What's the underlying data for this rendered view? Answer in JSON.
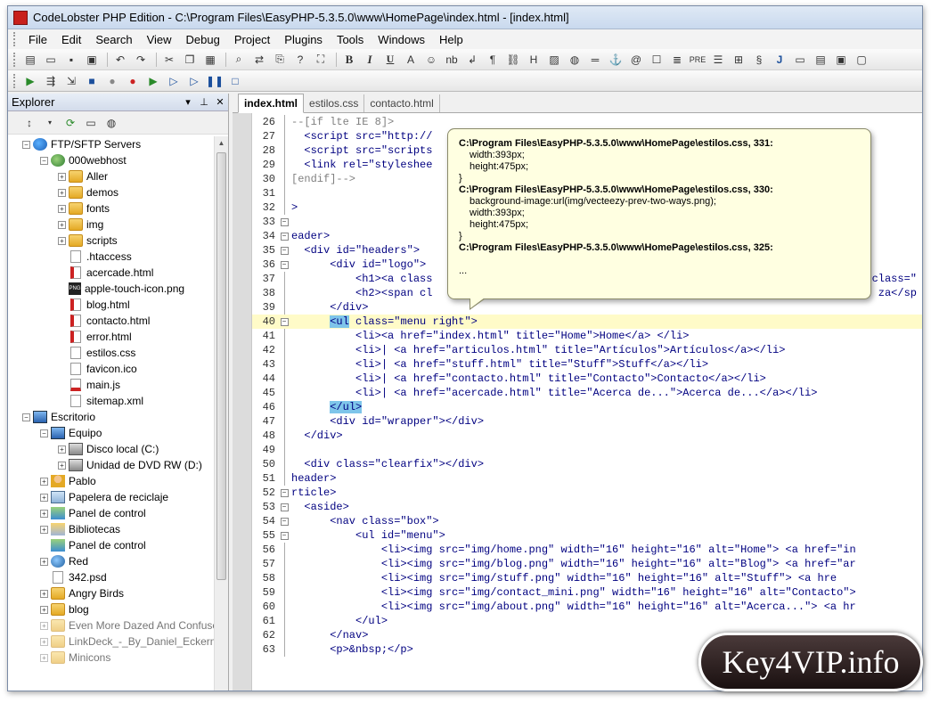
{
  "window": {
    "title": "CodeLobster PHP Edition - C:\\Program Files\\EasyPHP-5.3.5.0\\www\\HomePage\\index.html - [index.html]"
  },
  "menu": [
    "File",
    "Edit",
    "Search",
    "View",
    "Debug",
    "Project",
    "Plugins",
    "Tools",
    "Windows",
    "Help"
  ],
  "toolbar": {
    "bold": "B",
    "italic": "I",
    "underline": "U",
    "text_a": "A",
    "nb": "nb",
    "heading": "H",
    "pre": "PRE",
    "j": "J"
  },
  "explorer": {
    "title": "Explorer",
    "tree": [
      {
        "label": "FTP/SFTP Servers",
        "icon": "server-icon",
        "level": 0,
        "exp": "-"
      },
      {
        "label": "000webhost",
        "icon": "site-icon",
        "level": 1,
        "exp": "-"
      },
      {
        "label": "Aller",
        "icon": "folder-icon",
        "level": 2,
        "exp": "+"
      },
      {
        "label": "demos",
        "icon": "folder-icon",
        "level": 2,
        "exp": "+"
      },
      {
        "label": "fonts",
        "icon": "folder-icon",
        "level": 2,
        "exp": "+"
      },
      {
        "label": "img",
        "icon": "folder-icon",
        "level": 2,
        "exp": "+"
      },
      {
        "label": "scripts",
        "icon": "folder-icon",
        "level": 2,
        "exp": "+"
      },
      {
        "label": ".htaccess",
        "icon": "file-icon",
        "level": 2,
        "exp": ""
      },
      {
        "label": "acercade.html",
        "icon": "html-icon",
        "level": 2,
        "exp": ""
      },
      {
        "label": "apple-touch-icon.png",
        "icon": "png-icon",
        "level": 2,
        "exp": ""
      },
      {
        "label": "blog.html",
        "icon": "html-icon",
        "level": 2,
        "exp": ""
      },
      {
        "label": "contacto.html",
        "icon": "html-icon",
        "level": 2,
        "exp": ""
      },
      {
        "label": "error.html",
        "icon": "html-icon",
        "level": 2,
        "exp": ""
      },
      {
        "label": "estilos.css",
        "icon": "file-icon",
        "level": 2,
        "exp": ""
      },
      {
        "label": "favicon.ico",
        "icon": "file-icon",
        "level": 2,
        "exp": ""
      },
      {
        "label": "main.js",
        "icon": "js-icon",
        "level": 2,
        "exp": ""
      },
      {
        "label": "sitemap.xml",
        "icon": "file-icon",
        "level": 2,
        "exp": ""
      },
      {
        "label": "Escritorio",
        "icon": "pc-icon",
        "level": 0,
        "exp": "-"
      },
      {
        "label": "Equipo",
        "icon": "pc-icon",
        "level": 1,
        "exp": "-"
      },
      {
        "label": "Disco local (C:)",
        "icon": "disk-icon",
        "level": 2,
        "exp": "+"
      },
      {
        "label": "Unidad de DVD RW (D:)",
        "icon": "disk-icon",
        "level": 2,
        "exp": "+"
      },
      {
        "label": "Pablo",
        "icon": "user-folder-icon",
        "level": 1,
        "exp": "+"
      },
      {
        "label": "Papelera de reciclaje",
        "icon": "trash-icon",
        "level": 1,
        "exp": "+"
      },
      {
        "label": "Panel de control",
        "icon": "control-panel-icon",
        "level": 1,
        "exp": "+"
      },
      {
        "label": "Bibliotecas",
        "icon": "library-icon",
        "level": 1,
        "exp": "+"
      },
      {
        "label": "Panel de control",
        "icon": "control-panel-icon",
        "level": 1,
        "exp": ""
      },
      {
        "label": "Red",
        "icon": "network-icon",
        "level": 1,
        "exp": "+"
      },
      {
        "label": "342.psd",
        "icon": "file-icon",
        "level": 1,
        "exp": ""
      },
      {
        "label": "Angry Birds",
        "icon": "folder-icon",
        "level": 1,
        "exp": "+"
      },
      {
        "label": "blog",
        "icon": "folder-icon",
        "level": 1,
        "exp": "+"
      },
      {
        "label": "Even More Dazed And Confuse",
        "icon": "folder-icon",
        "level": 1,
        "exp": "+",
        "faded": true
      },
      {
        "label": "LinkDeck_-_By_Daniel_Eckerma",
        "icon": "folder-icon",
        "level": 1,
        "exp": "+",
        "faded": true
      },
      {
        "label": "Minicons",
        "icon": "folder-icon",
        "level": 1,
        "exp": "+",
        "faded": true
      }
    ]
  },
  "tabs": [
    "index.html",
    "estilos.css",
    "contacto.html"
  ],
  "code": [
    {
      "n": "26",
      "t": "--[if lte IE 8]>",
      "c": "cmt",
      "ind": 0
    },
    {
      "n": "27",
      "t": "  <script src=\"http://",
      "c": "tag",
      "ind": 0
    },
    {
      "n": "28",
      "t": "  <script src=\"scripts",
      "c": "tag",
      "ind": 0
    },
    {
      "n": "29",
      "t": "  <link rel=\"styleshee",
      "c": "tag",
      "ind": 0
    },
    {
      "n": "30",
      "t": "[endif]-->",
      "c": "cmt",
      "ind": 0
    },
    {
      "n": "31",
      "t": "",
      "c": "txt",
      "ind": 0
    },
    {
      "n": "32",
      "t": ">",
      "c": "tag",
      "ind": 0
    },
    {
      "n": "33",
      "t": "",
      "c": "txt",
      "ind": 0,
      "fold": "-"
    },
    {
      "n": "34",
      "t": "eader>",
      "c": "tag",
      "ind": 0,
      "fold": "-"
    },
    {
      "n": "35",
      "t": "  <div id=\"headers\">",
      "c": "tag",
      "ind": 0,
      "fold": "-"
    },
    {
      "n": "36",
      "t": "      <div id=\"logo\">",
      "c": "tag",
      "ind": 0,
      "fold": "-"
    },
    {
      "n": "37",
      "t": "          <h1><a class",
      "c": "tag",
      "ind": 0,
      "tail": "class=\""
    },
    {
      "n": "38",
      "t": "          <h2><span cl",
      "c": "tag",
      "ind": 0,
      "tail": "za</sp"
    },
    {
      "n": "39",
      "t": "      </div>",
      "c": "tag",
      "ind": 0
    },
    {
      "n": "40",
      "t": "      <ul class=\"menu right\">",
      "c": "tag",
      "ind": 0,
      "fold": "-",
      "hl": true,
      "selstart": "<ul"
    },
    {
      "n": "41",
      "t": "          <li><a href=\"index.html\" title=\"Home\">Home</a> </li>",
      "c": "tag",
      "ind": 0
    },
    {
      "n": "42",
      "t": "          <li>| <a href=\"articulos.html\" title=\"Artículos\">Artículos</a></li>",
      "c": "tag",
      "ind": 0
    },
    {
      "n": "43",
      "t": "          <li>| <a href=\"stuff.html\" title=\"Stuff\">Stuff</a></li>",
      "c": "tag",
      "ind": 0
    },
    {
      "n": "44",
      "t": "          <li>| <a href=\"contacto.html\" title=\"Contacto\">Contacto</a></li>",
      "c": "tag",
      "ind": 0
    },
    {
      "n": "45",
      "t": "          <li>| <a href=\"acercade.html\" title=\"Acerca de...\">Acerca de...</a></li>",
      "c": "tag",
      "ind": 0
    },
    {
      "n": "46",
      "t": "      </ul>",
      "c": "tag",
      "ind": 0,
      "selend": true
    },
    {
      "n": "47",
      "t": "      <div id=\"wrapper\"></div>",
      "c": "tag",
      "ind": 0
    },
    {
      "n": "48",
      "t": "  </div>",
      "c": "tag",
      "ind": 0
    },
    {
      "n": "49",
      "t": "",
      "c": "txt",
      "ind": 0
    },
    {
      "n": "50",
      "t": "  <div class=\"clearfix\"></div>",
      "c": "tag",
      "ind": 0
    },
    {
      "n": "51",
      "t": "header>",
      "c": "tag",
      "ind": 0
    },
    {
      "n": "52",
      "t": "rticle>",
      "c": "tag",
      "ind": 0,
      "fold": "-"
    },
    {
      "n": "53",
      "t": "  <aside>",
      "c": "tag",
      "ind": 0,
      "fold": "-"
    },
    {
      "n": "54",
      "t": "      <nav class=\"box\">",
      "c": "tag",
      "ind": 0,
      "fold": "-"
    },
    {
      "n": "55",
      "t": "          <ul id=\"menu\">",
      "c": "tag",
      "ind": 0,
      "fold": "-"
    },
    {
      "n": "56",
      "t": "              <li><img src=\"img/home.png\" width=\"16\" height=\"16\" alt=\"Home\"> <a href=\"in",
      "c": "tag",
      "ind": 0
    },
    {
      "n": "57",
      "t": "              <li><img src=\"img/blog.png\" width=\"16\" height=\"16\" alt=\"Blog\"> <a href=\"ar",
      "c": "tag",
      "ind": 0
    },
    {
      "n": "58",
      "t": "              <li><img src=\"img/stuff.png\" width=\"16\" height=\"16\" alt=\"Stuff\"> <a hre",
      "c": "tag",
      "ind": 0
    },
    {
      "n": "59",
      "t": "              <li><img src=\"img/contact_mini.png\" width=\"16\" height=\"16\" alt=\"Contacto\">",
      "c": "tag",
      "ind": 0
    },
    {
      "n": "60",
      "t": "              <li><img src=\"img/about.png\" width=\"16\" height=\"16\" alt=\"Acerca...\"> <a hr",
      "c": "tag",
      "ind": 0
    },
    {
      "n": "61",
      "t": "          </ul>",
      "c": "tag",
      "ind": 0
    },
    {
      "n": "62",
      "t": "      </nav>",
      "c": "tag",
      "ind": 0
    },
    {
      "n": "63",
      "t": "      <p>&nbsp;</p>",
      "c": "tag",
      "ind": 0
    }
  ],
  "tooltip": {
    "path1": "C:\\Program Files\\EasyPHP-5.3.5.0\\www\\HomePage\\estilos.css, 331:",
    "l1": "width:393px;",
    "l2": "height:475px;",
    "l3": "}",
    "path2": "C:\\Program Files\\EasyPHP-5.3.5.0\\www\\HomePage\\estilos.css, 330:",
    "l4": "background-image:url(img/vecteezy-prev-two-ways.png);",
    "l5": "width:393px;",
    "l6": "height:475px;",
    "l7": "}",
    "path3": "C:\\Program Files\\EasyPHP-5.3.5.0\\www\\HomePage\\estilos.css, 325:",
    "l8": "..."
  },
  "watermark": "Key4VIP.info"
}
